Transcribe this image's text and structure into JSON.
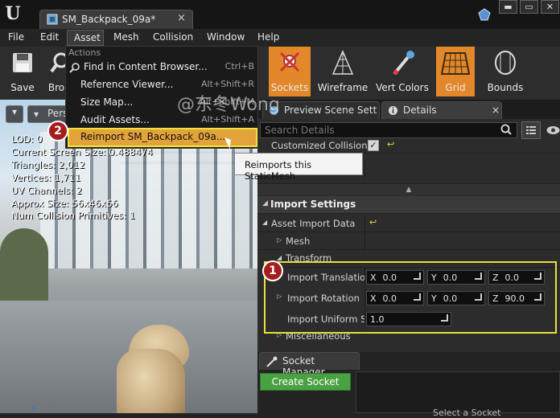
{
  "window": {
    "tab_title": "SM_Backpack_09a*",
    "tab_close": "×",
    "btn_min": "▬",
    "btn_max": "▭",
    "btn_close": "✕"
  },
  "menubar": [
    "File",
    "Edit",
    "Asset",
    "Mesh",
    "Collision",
    "Window",
    "Help"
  ],
  "toolbar_left": [
    {
      "label": "Save",
      "icon": "floppy-disk-icon"
    },
    {
      "label": "Bro",
      "icon": "magnifier-icon"
    }
  ],
  "toolbar_right": [
    {
      "label": "Sockets",
      "icon": "sockets-icon",
      "active": true
    },
    {
      "label": "Wireframe",
      "icon": "wireframe-icon",
      "active": false
    },
    {
      "label": "Vert Colors",
      "icon": "vert-colors-icon",
      "active": false
    },
    {
      "label": "Grid",
      "icon": "grid-icon",
      "active": true
    },
    {
      "label": "Bounds",
      "icon": "bounds-icon",
      "active": false
    }
  ],
  "asset_menu": {
    "section": "Actions",
    "items": [
      {
        "label": "Find in Content Browser...",
        "shortcut": "Ctrl+B"
      },
      {
        "label": "Reference Viewer...",
        "shortcut": "Alt+Shift+R"
      },
      {
        "label": "Size Map...",
        "shortcut": "Alt+Shift+M"
      },
      {
        "label": "Audit Assets...",
        "shortcut": "Alt+Shift+A"
      },
      {
        "label": "Reimport SM_Backpack_09a...",
        "shortcut": ""
      }
    ],
    "tooltip": "Reimports this StaticMesh"
  },
  "viewport": {
    "perspective_label": "Pers",
    "stats": [
      "LOD:  0",
      "Current Screen Size:  0.488474",
      "Triangles:  2,012",
      "Vertices:  1,711",
      "UV Channels:  2",
      "Approx Size: 56x46x66",
      "Num Collision Primitives:  1"
    ]
  },
  "panel_tabs": [
    "Preview Scene Sett",
    "Details"
  ],
  "details": {
    "search_placeholder": "Search Details",
    "customized_collision": "Customized Collision",
    "import_settings": "Import Settings",
    "asset_import_data": "Asset Import Data",
    "mesh": "Mesh",
    "transform": "Transform",
    "import_translation": {
      "label": "Import Translation",
      "x": "0.0",
      "y": "0.0",
      "z": "0.0"
    },
    "import_rotation": {
      "label": "Import Rotation",
      "x": "0.0",
      "y": "0.0",
      "z": "90.0"
    },
    "import_uniform_scale": {
      "label": "Import Uniform Sca",
      "value": "1.0"
    },
    "miscellaneous": "Miscellaneous"
  },
  "socket_manager": {
    "tab": "Socket Manager",
    "create_button": "Create Socket",
    "select_hint": "Select a Socket"
  },
  "badges": {
    "one": "1",
    "two": "2"
  },
  "watermark": "@东冬Wong",
  "colors": {
    "accent_orange": "#e2872a",
    "highlight_yellow": "#e8e03a",
    "badge_red": "#a51d1d",
    "create_green": "#4aa142"
  }
}
